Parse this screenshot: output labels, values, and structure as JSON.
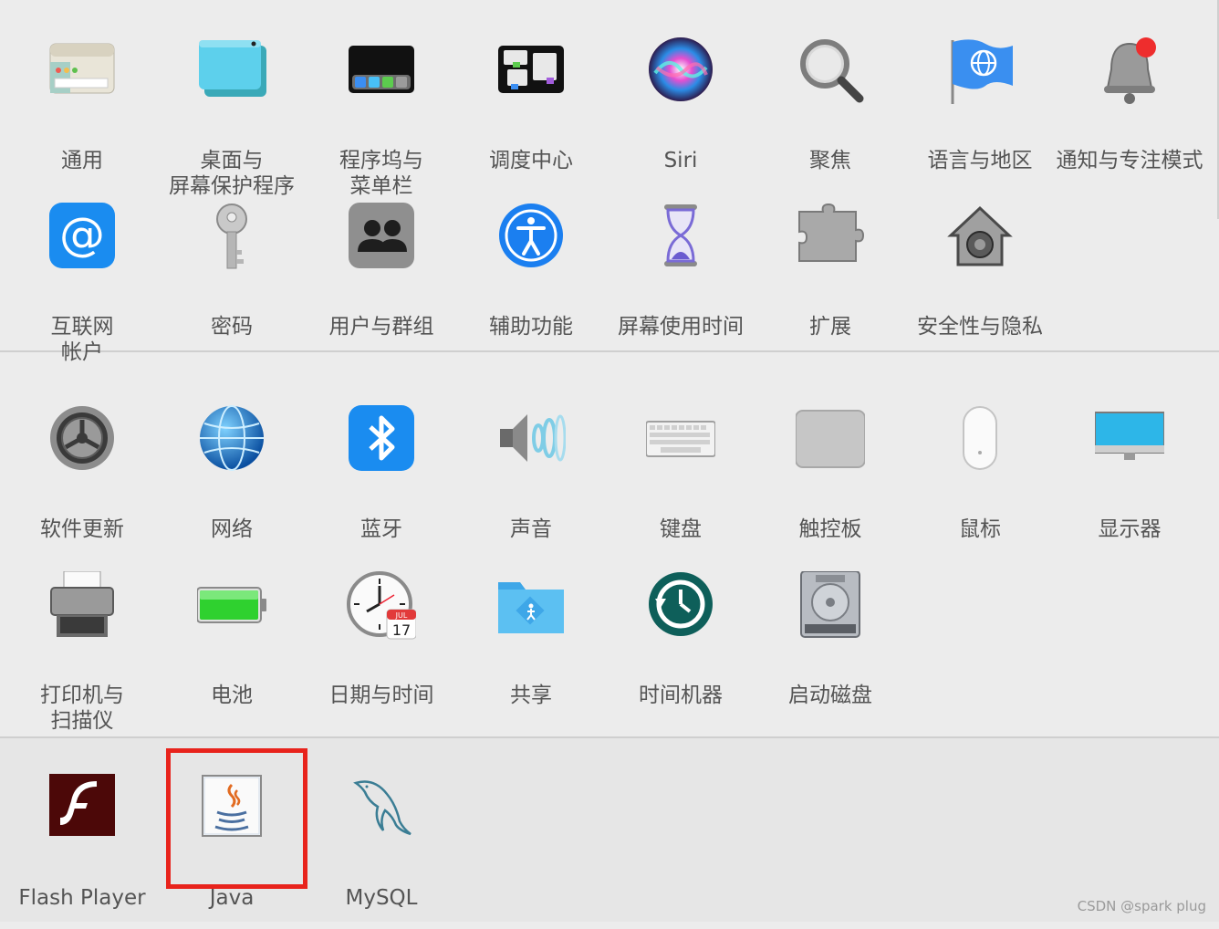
{
  "section_personal": {
    "row1": [
      {
        "label": "通用",
        "icon": "general-icon"
      },
      {
        "label": "桌面与\n屏幕保护程序",
        "icon": "desktop-screensaver-icon"
      },
      {
        "label": "程序坞与\n菜单栏",
        "icon": "dock-menubar-icon"
      },
      {
        "label": "调度中心",
        "icon": "mission-control-icon"
      },
      {
        "label": "Siri",
        "icon": "siri-icon"
      },
      {
        "label": "聚焦",
        "icon": "spotlight-icon"
      },
      {
        "label": "语言与地区",
        "icon": "language-region-icon"
      },
      {
        "label": "通知与专注模式",
        "icon": "notifications-icon"
      }
    ],
    "row2": [
      {
        "label": "互联网\n帐户",
        "icon": "internet-accounts-icon"
      },
      {
        "label": "密码",
        "icon": "passwords-key-icon"
      },
      {
        "label": "用户与群组",
        "icon": "users-groups-icon"
      },
      {
        "label": "辅助功能",
        "icon": "accessibility-icon"
      },
      {
        "label": "屏幕使用时间",
        "icon": "screen-time-icon"
      },
      {
        "label": "扩展",
        "icon": "extensions-icon"
      },
      {
        "label": "安全性与隐私",
        "icon": "security-privacy-icon"
      }
    ]
  },
  "section_hardware": {
    "row1": [
      {
        "label": "软件更新",
        "icon": "software-update-icon"
      },
      {
        "label": "网络",
        "icon": "network-icon"
      },
      {
        "label": "蓝牙",
        "icon": "bluetooth-icon"
      },
      {
        "label": "声音",
        "icon": "sound-icon"
      },
      {
        "label": "键盘",
        "icon": "keyboard-icon"
      },
      {
        "label": "触控板",
        "icon": "trackpad-icon"
      },
      {
        "label": "鼠标",
        "icon": "mouse-icon"
      },
      {
        "label": "显示器",
        "icon": "displays-icon"
      }
    ],
    "row2": [
      {
        "label": "打印机与\n扫描仪",
        "icon": "printer-icon"
      },
      {
        "label": "电池",
        "icon": "battery-icon"
      },
      {
        "label": "日期与时间",
        "icon": "date-time-icon"
      },
      {
        "label": "共享",
        "icon": "sharing-icon"
      },
      {
        "label": "时间机器",
        "icon": "time-machine-icon"
      },
      {
        "label": "启动磁盘",
        "icon": "startup-disk-icon"
      }
    ]
  },
  "section_other": {
    "row1": [
      {
        "label": "Flash Player",
        "icon": "flash-player-icon"
      },
      {
        "label": "Java",
        "icon": "java-icon"
      },
      {
        "label": "MySQL",
        "icon": "mysql-icon"
      }
    ]
  },
  "clock": {
    "month": "JUL",
    "day": "17"
  },
  "colors": {
    "highlight": "#e8231c",
    "label": "#545454"
  },
  "watermark": "CSDN @spark plug"
}
